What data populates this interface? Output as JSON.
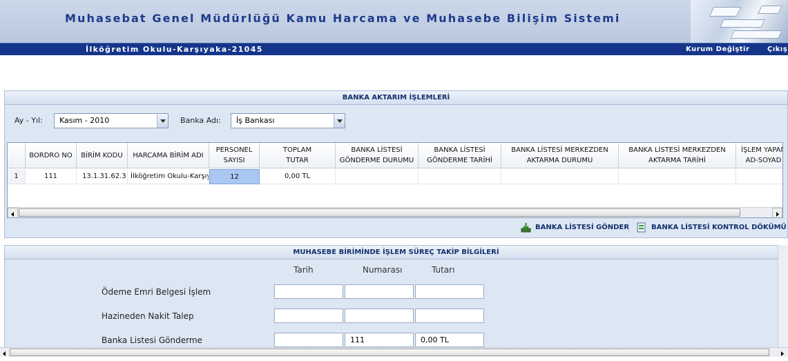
{
  "header": {
    "title": "Muhasebat Genel Müdürlüğü Kamu Harcama ve Muhasebe Bilişim Sistemi",
    "school": "İlköğretim Okulu-Karşıyaka-21045",
    "change_institution": "Kurum Değiştir",
    "logout": "Çıkış"
  },
  "bank_panel": {
    "title": "BANKA AKTARIM İŞLEMLERİ",
    "month_year_label": "Ay - Yıl:",
    "month_year_value": "Kasım - 2010",
    "bank_name_label": "Banka Adı:",
    "bank_name_value": "İş Bankası"
  },
  "grid": {
    "columns": [
      "BORDRO NO",
      "BİRİM KODU",
      "HARCAMA BİRİM ADI",
      "PERSONEL SAYISI",
      "TOPLAM TUTAR",
      "BANKA LİSTESİ GÖNDERME DURUMU",
      "BANKA LİSTESİ GÖNDERME TARİHİ",
      "BANKA LİSTESİ MERKEZDEN AKTARMA DURUMU",
      "BANKA LİSTESİ MERKEZDEN AKTARMA TARİHİ",
      "İŞLEM YAPAN AD-SOYAD"
    ],
    "rows": [
      {
        "row_number": "1",
        "bordro_no": "111",
        "birim_kodu": "13.1.31.62.3",
        "harcama_birim_adi": "İlköğretim Okulu-Karşıyaka",
        "personel_sayisi": "12",
        "toplam_tutar": "0,00 TL",
        "gonderme_durumu": "",
        "gonderme_tarihi": "",
        "aktarma_durumu": "",
        "aktarma_tarihi": "",
        "islem_yapan": ""
      }
    ]
  },
  "actions": {
    "send_bank_list": "BANKA LİSTESİ GÖNDER",
    "bank_list_control": "BANKA LİSTESİ KONTROL DÖKÜMÜ"
  },
  "process_panel": {
    "title": "MUHASEBE BİRİMİNDE İŞLEM SÜREÇ TAKİP BİLGİLERİ",
    "col_date": "Tarih",
    "col_number": "Numarası",
    "col_amount": "Tutarı",
    "rows": [
      {
        "label": "Ödeme Emri Belgesi İşlem",
        "date": "",
        "number": "",
        "amount": ""
      },
      {
        "label": "Hazineden Nakit Talep",
        "date": "",
        "number": "",
        "amount": ""
      },
      {
        "label": "Banka Listesi Gönderme",
        "date": "",
        "number": "111",
        "amount": "0,00 TL"
      }
    ]
  },
  "colors": {
    "navbar": "#14358a",
    "title_text": "#1d3a8a",
    "panel_bg": "#dde7f4",
    "selected_cell": "#a9c7f0"
  },
  "icons": [
    "download-icon",
    "document-icon",
    "chevron-down-icon",
    "arrow-left-icon",
    "arrow-right-icon"
  ]
}
